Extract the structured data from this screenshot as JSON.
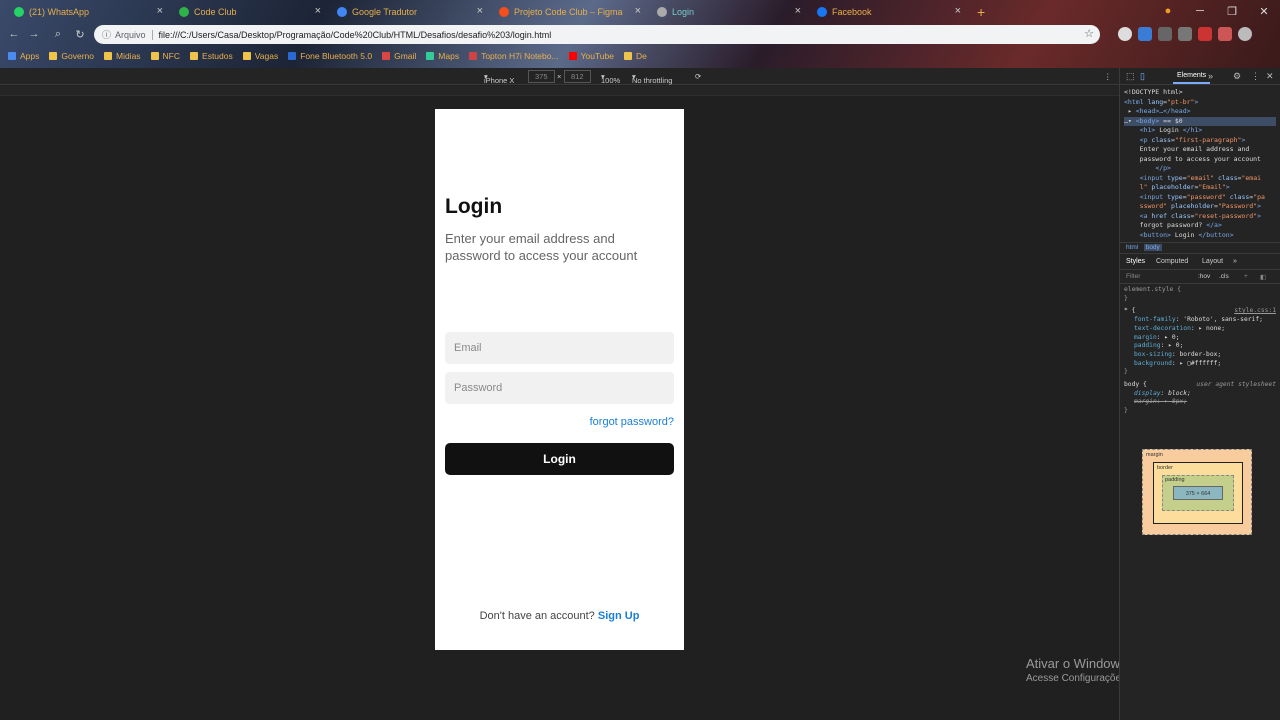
{
  "browser": {
    "tabs": [
      {
        "label": "(21) WhatsApp",
        "color": "#25d366"
      },
      {
        "label": "Code Club",
        "color": "#2fb24a"
      },
      {
        "label": "Google Tradutor",
        "color": "#4285f4"
      },
      {
        "label": "Projeto Code Club – Figma",
        "color": "#f24e1e"
      },
      {
        "label": "Login",
        "color": "#aaaaaa"
      },
      {
        "label": "Facebook",
        "color": "#1877f2"
      }
    ],
    "new_tab": "+",
    "address_info": "Arquivo",
    "url": "file:///C:/Users/Casa/Desktop/Programação/Code%20Club/HTML/Desafios/desafio%203/login.html",
    "bookmarks": [
      "Apps",
      "Governo",
      "Midias",
      "NFC",
      "Estudos",
      "Vagas",
      "Fone Bluetooth 5.0",
      "Gmail",
      "Maps",
      "Topton H7i Notebo...",
      "YouTube",
      "De"
    ]
  },
  "device_toolbar": {
    "device": "iPhone X",
    "width": "375",
    "x": "×",
    "height": "812",
    "zoom": "100%",
    "throttle": "No throttling"
  },
  "page": {
    "title": "Login",
    "subtitle": "Enter your email address and password to access your account",
    "email_placeholder": "Email",
    "password_placeholder": "Password",
    "forgot": "forgot password?",
    "login_button": "Login",
    "no_account": "Don't have an account?",
    "signup": "Sign Up"
  },
  "devtools": {
    "tab": "Elements",
    "breadcrumb_html": "html",
    "breadcrumb_body": "body",
    "subtabs": [
      "Styles",
      "Computed",
      "Layout"
    ],
    "filter": "Filter",
    "hov": ":hov",
    "cls": ".cls",
    "element_style": "element.style {",
    "source": "style.css:1",
    "ua": "user agent stylesheet",
    "content_size": "375 × 664",
    "margin_label": "margin",
    "border_label": "border",
    "padding_label": "padding"
  },
  "watermark": {
    "line1": "Ativar o Windows",
    "line2": "Acesse Configurações para ativar o Windows."
  }
}
